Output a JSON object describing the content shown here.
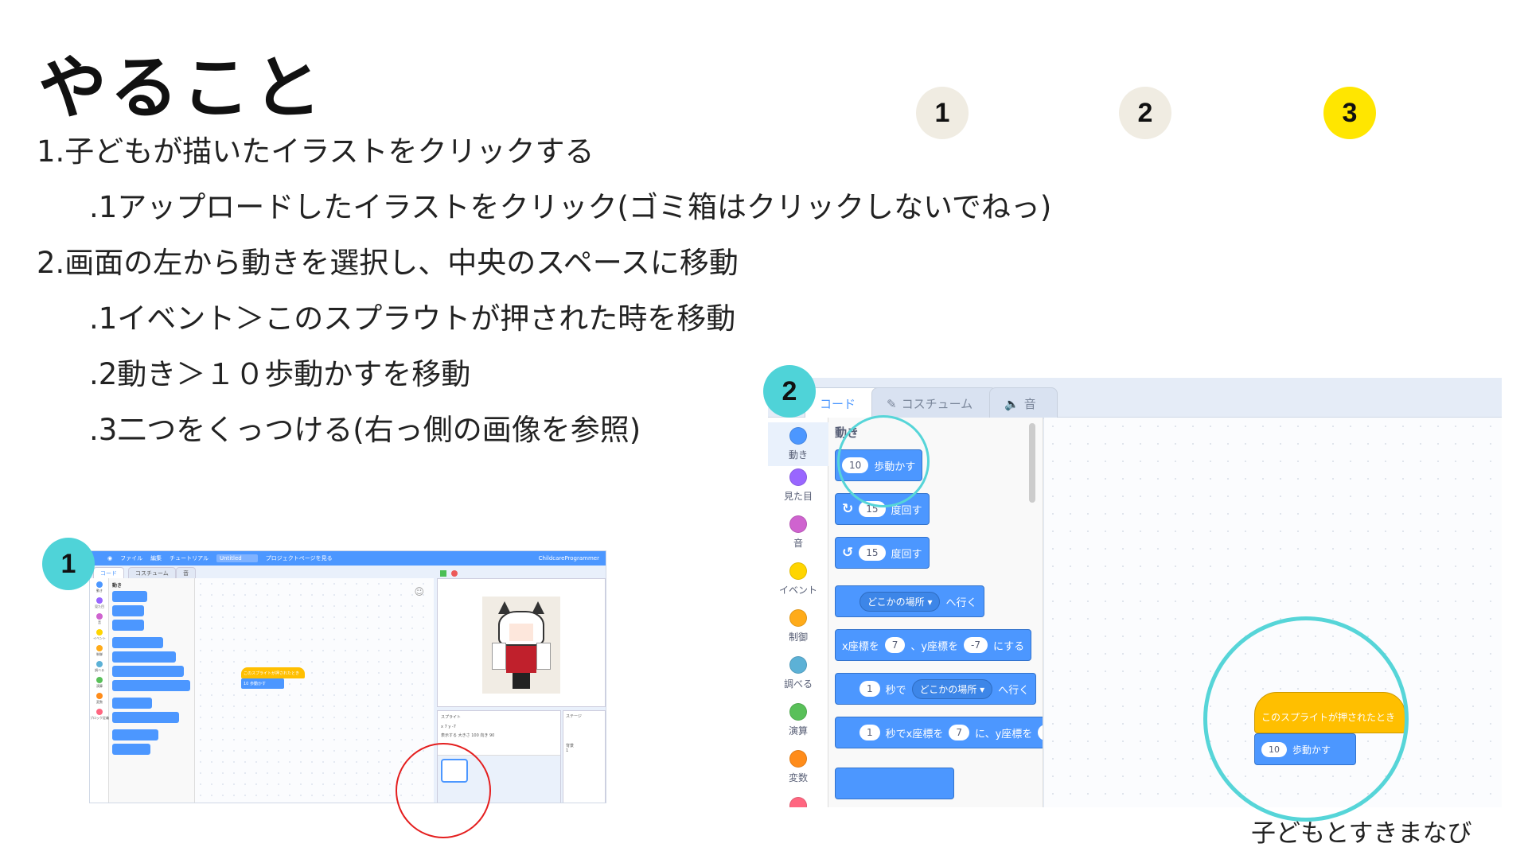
{
  "slide": {
    "title": "やること",
    "lines": [
      "1.子どもが描いたイラストをクリックする",
      ".1アップロードしたイラストをクリック(ゴミ箱はクリックしないでねっ)",
      "2.画面の左から動きを選択し、中央のスペースに移動",
      ".1イベント＞このスプラウトが押された時を移動",
      ".2動き＞１０歩動かすを移動",
      ".3二つをくっつける(右っ側の画像を参照)"
    ],
    "steps": [
      "1",
      "2",
      "3"
    ],
    "active_step": "3",
    "footer": "子どもとすきまなび",
    "colors": {
      "step_inactive": "#f0ece2",
      "step_active": "#ffe600",
      "badge": "#4fd3d8",
      "highlight_circle": "#56d5d8",
      "red_circle": "#e41e1e"
    }
  },
  "screenshot1": {
    "badge": "1",
    "menubar": {
      "file": "ファイル",
      "edit": "編集",
      "tutorial": "チュートリアル",
      "project_title": "Untitled",
      "project_page": "プロジェクトページを見る",
      "user": "ChildcareProgrammer"
    },
    "tabs": {
      "code": "コード",
      "costume": "コスチューム",
      "sound": "音"
    },
    "palette_heading": "動き",
    "categories": [
      "動き",
      "見た目",
      "音",
      "イベント",
      "制御",
      "調べる",
      "演算",
      "変数",
      "ブロック定義"
    ],
    "event_block": "このスプライトが押されたとき",
    "move_block": {
      "value": "10",
      "label": "歩動かす"
    },
    "sprite_pane": {
      "label": "スプライト",
      "show": "表示する",
      "size": "大きさ",
      "direction": "向き",
      "size_value": "100",
      "direction_value": "90",
      "x": "x",
      "y": "y",
      "x_value": "7",
      "y_value": "-7"
    },
    "stage_label": "ステージ",
    "backdrop_label": "背景",
    "backdrop_count": "1"
  },
  "screenshot2": {
    "badge": "2",
    "tabs": {
      "code": "コード",
      "costume": "コスチューム",
      "sound": "音"
    },
    "categories": [
      {
        "label": "動き",
        "color": "#4c97ff"
      },
      {
        "label": "見た目",
        "color": "#9966ff"
      },
      {
        "label": "音",
        "color": "#cf63cf"
      },
      {
        "label": "イベント",
        "color": "#ffd500"
      },
      {
        "label": "制御",
        "color": "#ffab19"
      },
      {
        "label": "調べる",
        "color": "#5cb1d6"
      },
      {
        "label": "演算",
        "color": "#59c059"
      },
      {
        "label": "変数",
        "color": "#ff8c1a"
      }
    ],
    "palette_heading": "動き",
    "blocks": {
      "move": {
        "value": "10",
        "label": "歩動かす"
      },
      "turn_right": {
        "value": "15",
        "label": "度回す"
      },
      "turn_left": {
        "value": "15",
        "label": "度回す"
      },
      "goto": {
        "drop": "どこかの場所",
        "label": "へ行く"
      },
      "goto_xy": {
        "x_label": "x座標を",
        "x": "7",
        "y_label": "、y座標を",
        "y": "-7",
        "end": "にする"
      },
      "glide": {
        "value": "1",
        "sec": "秒で",
        "drop": "どこかの場所",
        "label": "へ行く"
      },
      "glide_xy": {
        "value": "1",
        "label": "秒でx座標を",
        "x": "7",
        "mid": "に、y座標を",
        "end": "-"
      }
    },
    "workspace": {
      "event_block": "このスプライトが押されたとき",
      "move_block": {
        "value": "10",
        "label": "歩動かす"
      }
    }
  }
}
